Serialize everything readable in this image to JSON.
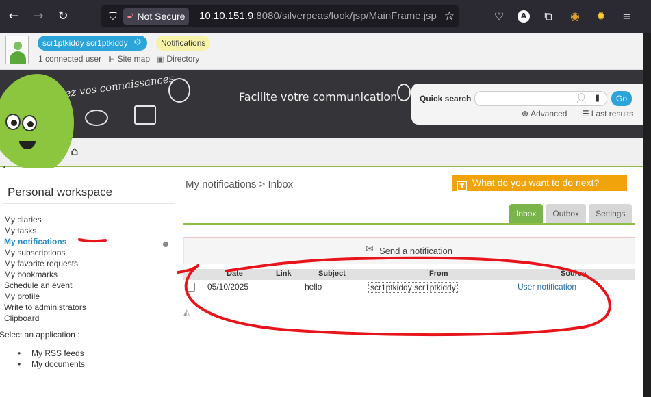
{
  "browser": {
    "security_label": "Not Secure",
    "url_host": "10.10.151.9",
    "url_rest": ":8080/silverpeas/look/jsp/MainFrame.jsp",
    "account_badge": "A"
  },
  "topbar": {
    "username": "scr1ptkiddy scr1ptkiddy",
    "notifications_label": "Notifications",
    "connected_users": "1 connected user",
    "site_map": "Site map",
    "directory": "Directory"
  },
  "banner": {
    "tagline": "Partagez vos connaissances",
    "slogan": "Facilite votre communication"
  },
  "quick_search": {
    "label": "Quick search",
    "go_label": "Go",
    "advanced_label": "Advanced",
    "last_results_label": "Last results"
  },
  "sidebar": {
    "title": "Personal workspace",
    "items": [
      {
        "label": "My diaries"
      },
      {
        "label": "My tasks"
      },
      {
        "label": "My notifications"
      },
      {
        "label": "My subscriptions"
      },
      {
        "label": "My favorite requests"
      },
      {
        "label": "My bookmarks"
      },
      {
        "label": "Schedule an event"
      },
      {
        "label": "My profile"
      },
      {
        "label": "Write to administrators"
      },
      {
        "label": "Clipboard"
      }
    ],
    "select_app_label": "Select an application :",
    "apps": [
      {
        "label": "My RSS feeds"
      },
      {
        "label": "My documents"
      }
    ]
  },
  "main": {
    "breadcrumb_parent": "My notifications",
    "breadcrumb_sep": ">",
    "breadcrumb_current": "Inbox",
    "what_to_do_label": "What do you want to do next?",
    "tabs": [
      {
        "label": "Inbox"
      },
      {
        "label": "Outbox"
      },
      {
        "label": "Settings"
      }
    ],
    "send_notification_label": "Send a notification",
    "table": {
      "columns": [
        "Date",
        "Link",
        "Subject",
        "From",
        "Source"
      ],
      "rows": [
        {
          "date": "05/10/2025",
          "link": "",
          "subject": "hello",
          "from": "scr1ptkiddy scr1ptkiddy",
          "source": "User notification"
        }
      ]
    }
  },
  "colors": {
    "accent_blue": "#2aa4d9",
    "accent_green": "#8dbf48",
    "action_orange": "#f0a30a",
    "annotation_red": "#e8141c"
  },
  "icons": [
    "back-arrow-icon",
    "forward-arrow-icon",
    "reload-icon",
    "shield-icon",
    "lock-slash-icon",
    "bookmark-star-icon",
    "pocket-icon",
    "extensions-icon",
    "menu-icon",
    "gear-icon",
    "sitemap-icon",
    "directory-icon",
    "person-icon",
    "clipboard-icon",
    "search-plus-icon",
    "list-icon",
    "home-icon",
    "envelope-icon"
  ]
}
